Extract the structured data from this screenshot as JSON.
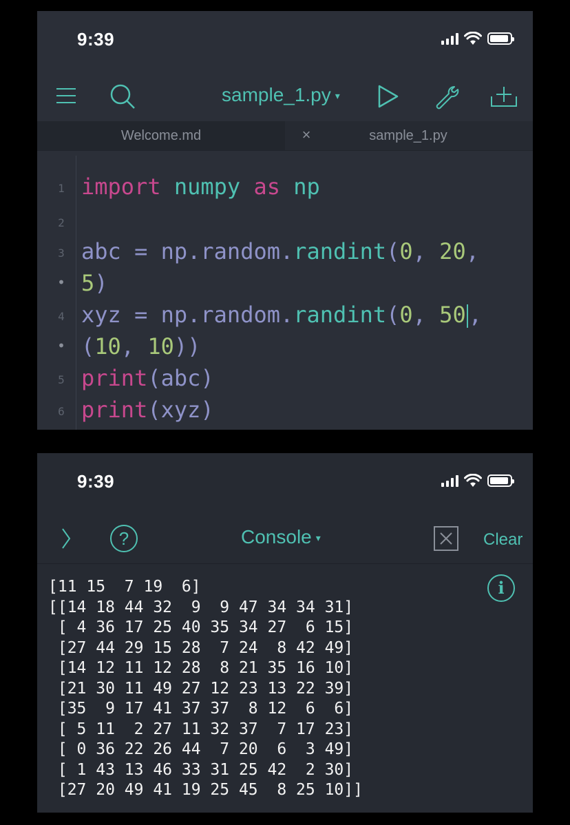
{
  "editor": {
    "status_time": "9:39",
    "file_title": "sample_1.py",
    "title_caret": "▾",
    "tabs": [
      {
        "label": "Welcome.md"
      },
      {
        "label": "sample_1.py"
      }
    ],
    "tab_close": "×",
    "line_numbers": [
      "1",
      "2",
      "3",
      "•",
      "4",
      "•",
      "5",
      "6"
    ],
    "code": {
      "l1": {
        "kw": "import",
        "mod": "numpy",
        "kw2": "as",
        "alias": "np"
      },
      "l3": {
        "var": "abc",
        "eq": " = ",
        "obj": "np.random.",
        "fn": "randint",
        "open": "(",
        "a": "0",
        "sep1": ", ",
        "b": "20",
        "sep2": ","
      },
      "l3b": {
        "c": "5",
        "close": ")"
      },
      "l4": {
        "var": "xyz",
        "eq": " = ",
        "obj": "np.random.",
        "fn": "randint",
        "open": "(",
        "a": "0",
        "sep1": ", ",
        "b": "50",
        "sep2": ","
      },
      "l4b": {
        "open": "(",
        "a": "10",
        "sep": ", ",
        "b": "10",
        "close": "))"
      },
      "l5": {
        "fn": "print",
        "arg": "(abc)"
      },
      "l6": {
        "fn": "print",
        "arg": "(xyz)"
      }
    }
  },
  "console": {
    "status_time": "9:39",
    "title": "Console",
    "title_caret": "▾",
    "clear_label": "Clear",
    "info_glyph": "i",
    "help_glyph": "?",
    "output": "[11 15  7 19  6]\n[[14 18 44 32  9  9 47 34 34 31]\n [ 4 36 17 25 40 35 34 27  6 15]\n [27 44 29 15 28  7 24  8 42 49]\n [14 12 11 12 28  8 21 35 16 10]\n [21 30 11 49 27 12 23 13 22 39]\n [35  9 17 41 37 37  8 12  6  6]\n [ 5 11  2 27 11 32 37  7 17 23]\n [ 0 36 22 26 44  7 20  6  3 49]\n [ 1 43 13 46 33 31 25 42  2 30]\n [27 20 49 41 19 25 45  8 25 10]]"
  },
  "colors": {
    "accent": "#4fc1b2",
    "keyword": "#c8488e",
    "number": "#a9c97a",
    "identifier": "#8f93c9"
  }
}
